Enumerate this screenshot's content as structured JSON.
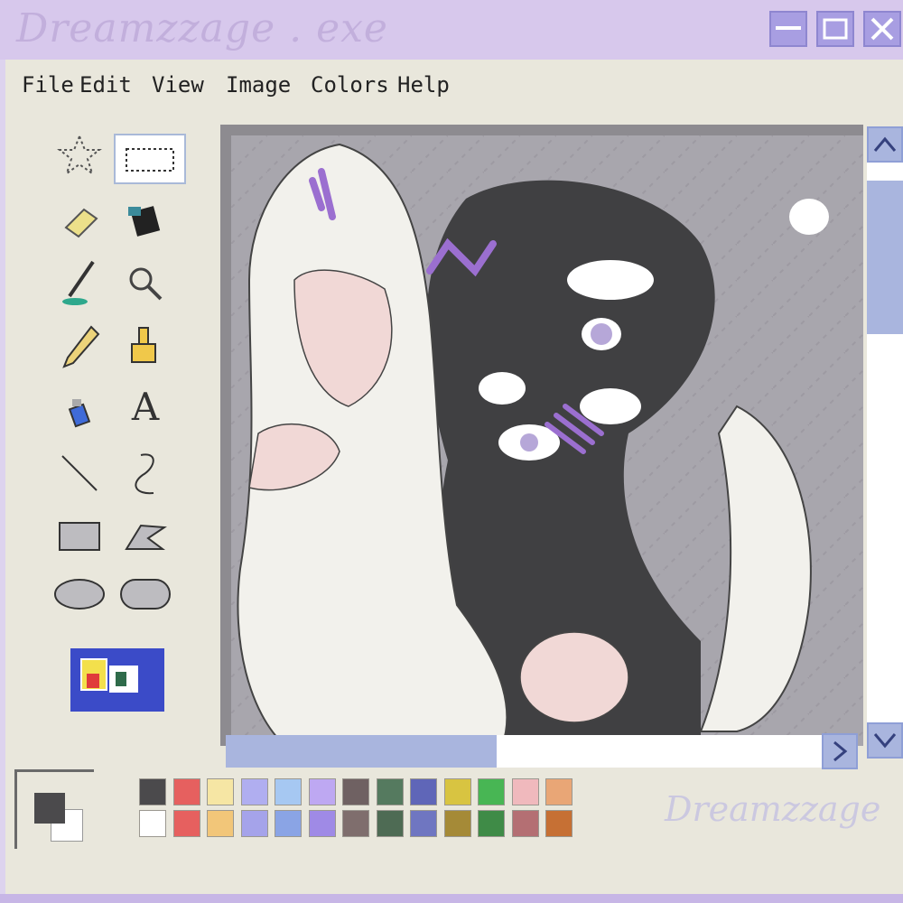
{
  "window": {
    "title": "Dreamzzage . exe",
    "controls": {
      "minimize": "minimize",
      "maximize": "maximize",
      "close": "close"
    }
  },
  "menu": {
    "items": [
      "File",
      "Edit",
      "View",
      "Image",
      "Colors",
      "Help"
    ]
  },
  "toolbox": {
    "tools": [
      {
        "name": "free-select",
        "icon": "star-select-icon"
      },
      {
        "name": "rect-select",
        "icon": "rect-select-icon"
      },
      {
        "name": "eraser",
        "icon": "eraser-icon"
      },
      {
        "name": "fill",
        "icon": "paint-bucket-icon"
      },
      {
        "name": "pick-color",
        "icon": "eyedropper-icon"
      },
      {
        "name": "magnifier",
        "icon": "magnifier-icon"
      },
      {
        "name": "pencil",
        "icon": "pencil-icon"
      },
      {
        "name": "brush",
        "icon": "brush-icon"
      },
      {
        "name": "airbrush",
        "icon": "spraycan-icon"
      },
      {
        "name": "text",
        "icon": "text-icon",
        "glyph": "A"
      },
      {
        "name": "line",
        "icon": "line-icon"
      },
      {
        "name": "curve",
        "icon": "curve-icon"
      },
      {
        "name": "rectangle",
        "icon": "rectangle-icon"
      },
      {
        "name": "polygon",
        "icon": "polygon-icon"
      },
      {
        "name": "ellipse",
        "icon": "ellipse-icon"
      },
      {
        "name": "rounded-rect",
        "icon": "rounded-rect-icon"
      }
    ]
  },
  "scrollbars": {
    "up": "^",
    "down": "V",
    "right": ">"
  },
  "palette": {
    "primary": "#4b4a4c",
    "secondary": "#ffffff",
    "top_row": [
      "#4b4a4c",
      "#e6605f",
      "#f6e6a4",
      "#b0aef0",
      "#a6c8f2",
      "#bea8f2",
      "#6f6162",
      "#557a5f",
      "#5f66b8",
      "#d8c441",
      "#48b654",
      "#f0b9bd",
      "#e9a676"
    ],
    "bottom_row": [
      "#ffffff",
      "#e6605f",
      "#f2c679",
      "#a5a3ea",
      "#8aa4e5",
      "#9f8ae6",
      "#7f6e6d",
      "#4e6b54",
      "#6f76c1",
      "#a58a37",
      "#3f8b47",
      "#b46f73",
      "#c67034"
    ]
  },
  "watermark": "Dreamzzage"
}
